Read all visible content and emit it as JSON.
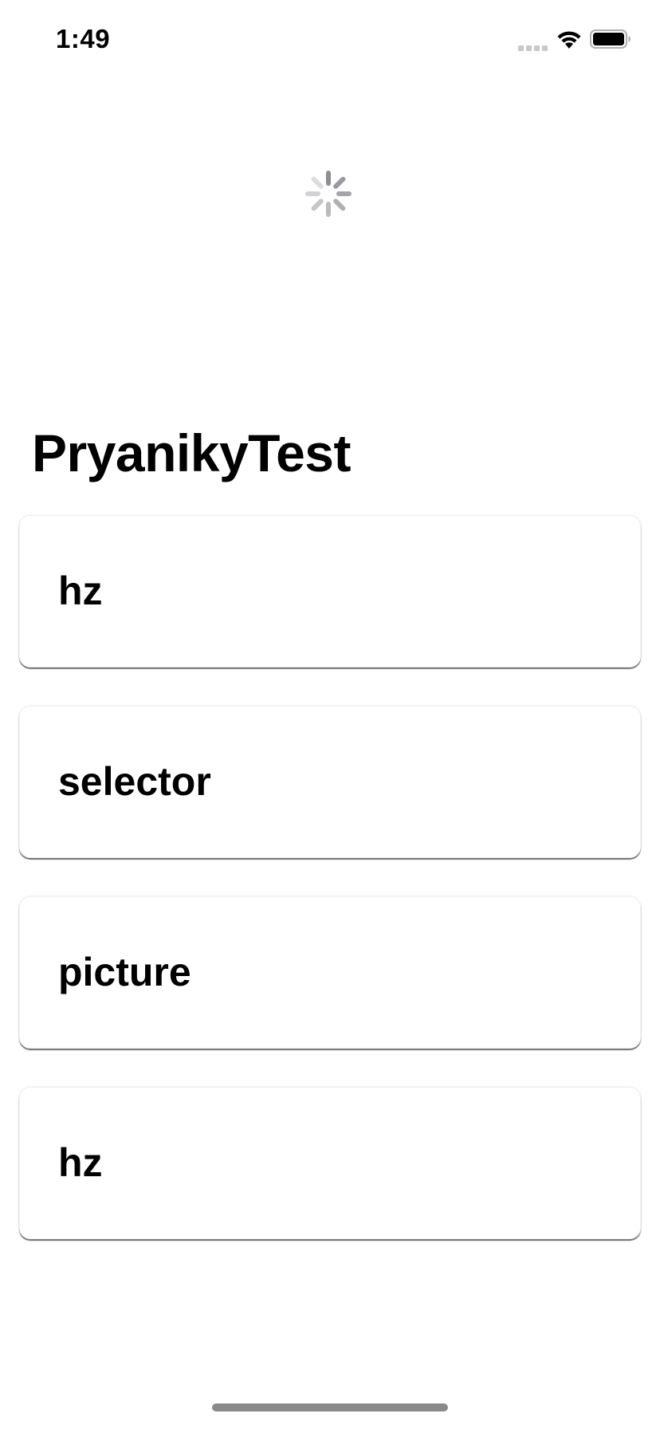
{
  "status_bar": {
    "time": "1:49",
    "icons": [
      "signal-icon",
      "wifi-icon",
      "battery-icon"
    ]
  },
  "loading": {
    "icon": "activity-spinner-icon"
  },
  "header": {
    "title": "PryanikyTest"
  },
  "list": {
    "items": [
      {
        "label": "hz"
      },
      {
        "label": "selector"
      },
      {
        "label": "picture"
      },
      {
        "label": "hz"
      }
    ]
  },
  "colors": {
    "background": "#ffffff",
    "text": "#000000",
    "spinner": "#8e8e93",
    "home_indicator": "#8a8a8a"
  }
}
